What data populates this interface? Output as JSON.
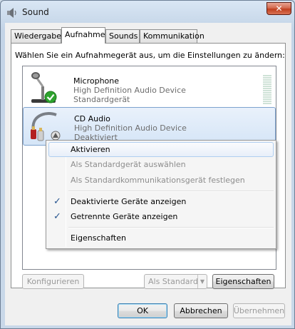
{
  "window": {
    "title": "Sound"
  },
  "tabs": [
    {
      "label": "Wiedergabe"
    },
    {
      "label": "Aufnahme"
    },
    {
      "label": "Sounds"
    },
    {
      "label": "Kommunikation"
    }
  ],
  "active_tab": "Aufnahme",
  "instruction": "Wählen Sie ein Aufnahmegerät aus, um die Einstellungen zu ändern:",
  "devices": [
    {
      "name": "Microphone",
      "driver": "High Definition Audio Device",
      "status": "Standardgerät",
      "selected": false
    },
    {
      "name": "CD Audio",
      "driver": "High Definition Audio Device",
      "status": "Deaktiviert",
      "selected": true
    }
  ],
  "context_menu": {
    "items": [
      {
        "label": "Aktivieren",
        "enabled": true,
        "hover": true,
        "checked": false
      },
      {
        "label": "Als Standardgerät auswählen",
        "enabled": false,
        "checked": false
      },
      {
        "label": "Als Standardkommunikationsgerät festlegen",
        "enabled": false,
        "checked": false
      },
      {
        "label": "Deaktivierte Geräte anzeigen",
        "enabled": true,
        "checked": true
      },
      {
        "label": "Getrennte Geräte anzeigen",
        "enabled": true,
        "checked": true
      },
      {
        "label": "Eigenschaften",
        "enabled": true,
        "checked": false
      }
    ],
    "check_glyph": "✓"
  },
  "panel_buttons": {
    "configure": "Konfigurieren",
    "set_default": "Als Standard",
    "properties": "Eigenschaften"
  },
  "dialog_buttons": {
    "ok": "OK",
    "cancel": "Abbrechen",
    "apply": "Übernehmen"
  },
  "colors": {
    "accent_check": "#27548f",
    "selection_border": "#7da2ce",
    "close_button": "#c0401f",
    "default_badge": "#2ea32e",
    "disabled_text": "#8d8d8d"
  },
  "icons": {
    "window": "speaker-icon",
    "close": "close-icon",
    "microphone": "microphone-icon",
    "default_badge": "checkmark-badge-icon",
    "cd_audio": "cd-audio-cable-icon",
    "disabled_badge": "disabled-badge-icon",
    "dropdown": "chevron-down-icon"
  }
}
